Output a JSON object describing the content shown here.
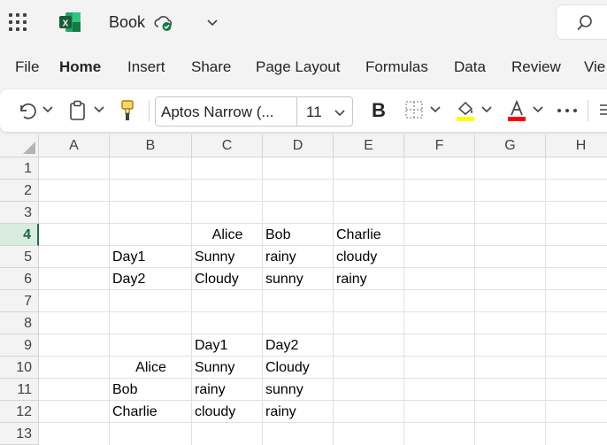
{
  "app": {
    "title": "Book",
    "icons": [
      "app-launcher-icon",
      "excel-logo-icon",
      "cloud-saved-icon",
      "chevron-down-icon",
      "search-icon"
    ]
  },
  "menu": {
    "tabs": [
      {
        "label": "File"
      },
      {
        "label": "Home"
      },
      {
        "label": "Insert"
      },
      {
        "label": "Share"
      },
      {
        "label": "Page Layout"
      },
      {
        "label": "Formulas"
      },
      {
        "label": "Data"
      },
      {
        "label": "Review"
      },
      {
        "label": "Vie"
      }
    ],
    "active": "Home"
  },
  "ribbon": {
    "font_name": "Aptos Narrow (...",
    "font_size": "11",
    "bold_label": "B",
    "colors": {
      "highlight": "#ffff00",
      "font_color": "#ff0000"
    }
  },
  "sheet": {
    "columns": [
      "A",
      "B",
      "C",
      "D",
      "E",
      "F",
      "G",
      "H"
    ],
    "rows": [
      "1",
      "2",
      "3",
      "4",
      "5",
      "6",
      "7",
      "8",
      "9",
      "10",
      "11",
      "12",
      "13"
    ],
    "selected_row": "4",
    "cells": {
      "C4": "Alice",
      "D4": "Bob",
      "E4": "Charlie",
      "B5": "Day1",
      "C5": "Sunny",
      "D5": "rainy",
      "E5": "cloudy",
      "B6": "Day2",
      "C6": "Cloudy",
      "D6": "sunny",
      "E6": "rainy",
      "C9": "Day1",
      "D9": "Day2",
      "B10": "Alice",
      "C10": "Sunny",
      "D10": "Cloudy",
      "B11": "Bob",
      "C11": "rainy",
      "D11": "sunny",
      "B12": "Charlie",
      "C12": "cloudy",
      "D12": "rainy"
    }
  },
  "accent_color": "#1e7145"
}
